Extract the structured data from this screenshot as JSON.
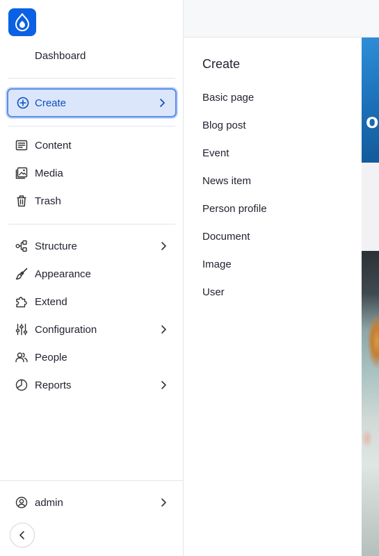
{
  "app": {
    "brand_color": "#0b61e3",
    "accent_active_bg": "#dbe6fb",
    "accent_active_text": "#0b4fc0"
  },
  "sidebar": {
    "logo_icon": "drupal-drop-icon",
    "dashboard_label": "Dashboard",
    "create": {
      "label": "Create",
      "icon": "plus-circle-icon",
      "active": true
    },
    "items_group1": [
      {
        "label": "Content",
        "icon": "content-icon"
      },
      {
        "label": "Media",
        "icon": "media-icon"
      },
      {
        "label": "Trash",
        "icon": "trash-icon"
      }
    ],
    "items_group2": [
      {
        "label": "Structure",
        "icon": "structure-icon",
        "has_submenu": true
      },
      {
        "label": "Appearance",
        "icon": "brush-icon",
        "has_submenu": false
      },
      {
        "label": "Extend",
        "icon": "puzzle-icon",
        "has_submenu": false
      },
      {
        "label": "Configuration",
        "icon": "sliders-icon",
        "has_submenu": true
      },
      {
        "label": "People",
        "icon": "people-icon",
        "has_submenu": false
      },
      {
        "label": "Reports",
        "icon": "pie-chart-icon",
        "has_submenu": true
      }
    ],
    "user": {
      "label": "admin",
      "icon": "user-circle-icon"
    },
    "collapse_icon": "chevron-left-icon"
  },
  "flyout": {
    "title": "Create",
    "items": [
      {
        "label": "Basic page"
      },
      {
        "label": "Blog post"
      },
      {
        "label": "Event"
      },
      {
        "label": "News item"
      },
      {
        "label": "Person profile"
      },
      {
        "label": "Document"
      },
      {
        "label": "Image"
      },
      {
        "label": "User"
      }
    ]
  },
  "background_page": {
    "hero_text": "ou"
  }
}
